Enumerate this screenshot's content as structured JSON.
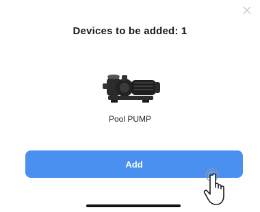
{
  "dialog": {
    "title": "Devices to be added: 1",
    "close_icon": "close-icon"
  },
  "device": {
    "name": "Pool PUMP",
    "image_icon": "pool-pump-image"
  },
  "actions": {
    "add_label": "Add"
  },
  "colors": {
    "accent": "#4a90f0",
    "title_text": "#1a1a1a",
    "background": "#ffffff",
    "home_indicator": "#111111"
  },
  "overlay": {
    "cursor_icon": "hand-pointer-icon"
  }
}
